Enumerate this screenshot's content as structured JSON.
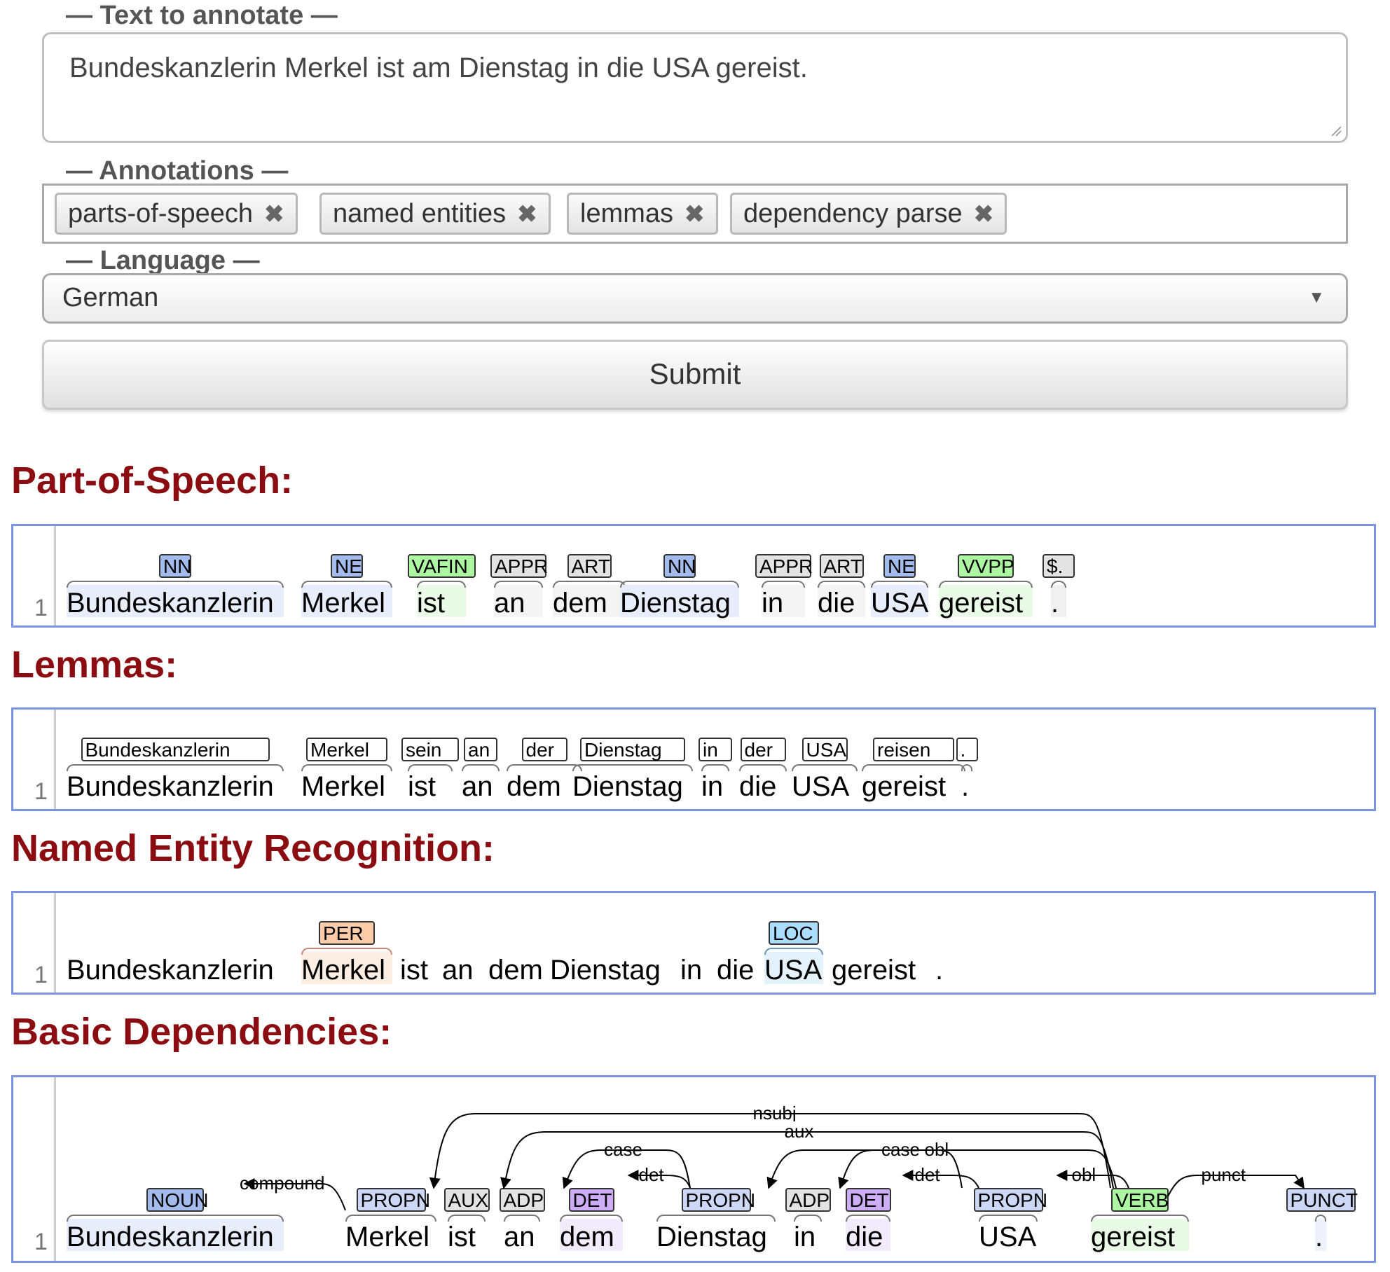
{
  "form": {
    "text_legend": "Text to annotate",
    "text_value": "Bundeskanzlerin Merkel ist am Dienstag in die USA gereist.",
    "annotations_legend": "Annotations",
    "annotations": [
      "parts-of-speech",
      "named entities",
      "lemmas",
      "dependency parse"
    ],
    "language_legend": "Language",
    "language_value": "German",
    "submit_label": "Submit"
  },
  "pos": {
    "title": "Part-of-Speech:",
    "line": "1",
    "tokens": [
      "Bundeskanzlerin",
      "Merkel",
      "ist",
      "an",
      "dem",
      "Dienstag",
      "in",
      "die",
      "USA",
      "gereist",
      "."
    ],
    "tags": [
      "NN",
      "NE",
      "VAFIN",
      "APPR",
      "ART",
      "NN",
      "APPR",
      "ART",
      "NE",
      "VVPP",
      "$."
    ]
  },
  "lemmas": {
    "title": "Lemmas:",
    "line": "1",
    "tokens": [
      "Bundeskanzlerin",
      "Merkel",
      "ist",
      "an",
      "dem",
      "Dienstag",
      "in",
      "die",
      "USA",
      "gereist",
      "."
    ],
    "lemmas": [
      "Bundeskanzlerin",
      "Merkel",
      "sein",
      "an",
      "der",
      "Dienstag",
      "in",
      "der",
      "USA",
      "reisen",
      "."
    ]
  },
  "ner": {
    "title": "Named Entity Recognition:",
    "line": "1",
    "tokens": [
      "Bundeskanzlerin",
      "Merkel",
      "ist",
      "an",
      "dem",
      "Dienstag",
      "in",
      "die",
      "USA",
      "gereist",
      "."
    ],
    "entities": [
      "PER",
      "LOC"
    ]
  },
  "deps": {
    "title": "Basic Dependencies:",
    "line": "1",
    "tokens": [
      "Bundeskanzlerin",
      "Merkel",
      "ist",
      "an",
      "dem",
      "Dienstag",
      "in",
      "die",
      "USA",
      "gereist",
      "."
    ],
    "upos": [
      "NOUN",
      "PROPN",
      "AUX",
      "ADP",
      "DET",
      "PROPN",
      "ADP",
      "DET",
      "PROPN",
      "VERB",
      "PUNCT"
    ],
    "relations": [
      "compound",
      "nsubj",
      "aux",
      "case",
      "det",
      "obl",
      "case",
      "det",
      "obl",
      "punct"
    ]
  },
  "colors": {
    "accent_title": "#8b0d12",
    "panel_border": "#7b93e0",
    "nn": "#a4bced",
    "ne": "#a4bced",
    "verb": "#adf6a2",
    "misc": "#e3e3e3",
    "det": "#ccadf6",
    "propn": "#ccd8f6",
    "per": "#ffccaa",
    "loc": "#aaddff"
  }
}
